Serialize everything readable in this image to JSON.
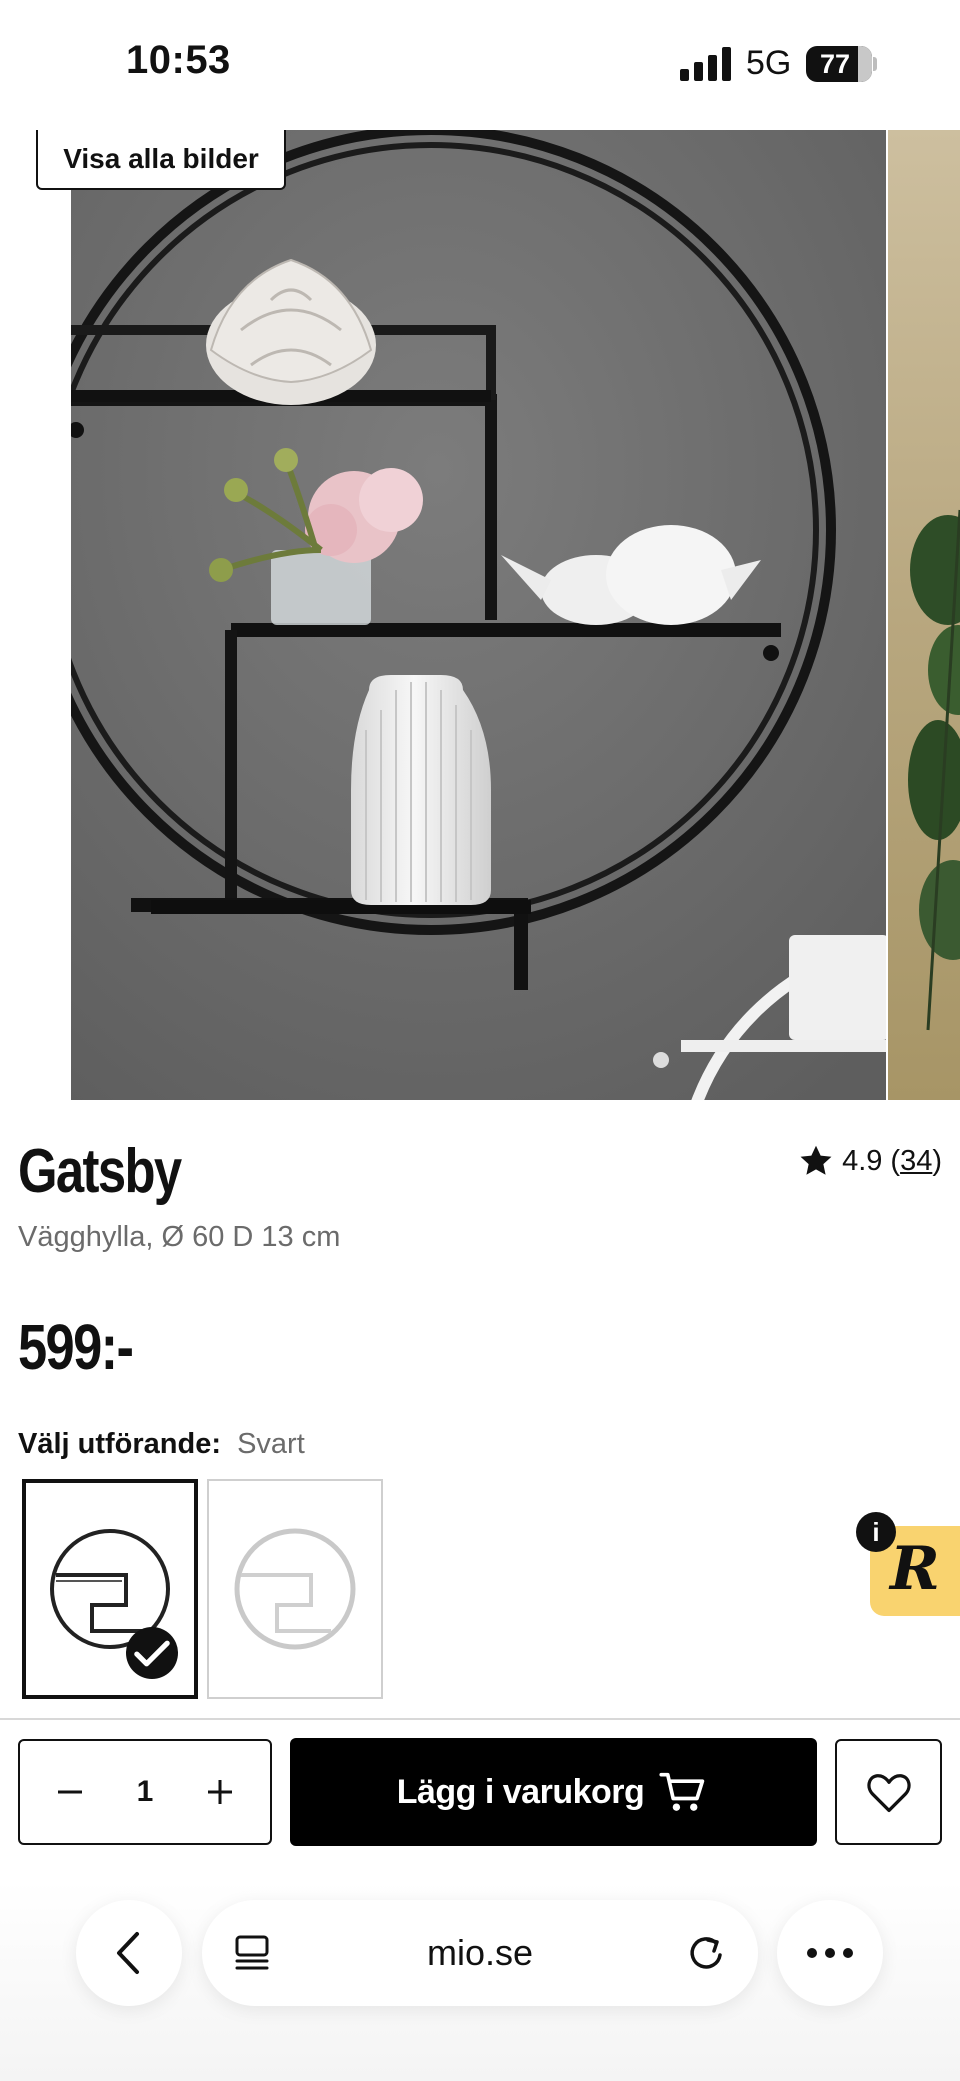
{
  "status_bar": {
    "time": "10:53",
    "network": "5G",
    "battery": "77"
  },
  "gallery": {
    "view_all_label": "Visa alla bilder"
  },
  "product": {
    "title": "Gatsby",
    "subtitle": "Vägghylla, Ø 60 D 13 cm",
    "rating": "4.9",
    "rating_count": "34",
    "price": "599:-"
  },
  "variant": {
    "label": "Välj utförande:",
    "selected_value": "Svart",
    "options": [
      {
        "name": "Svart",
        "selected": true
      },
      {
        "name": "Vit",
        "selected": false
      }
    ]
  },
  "purchase": {
    "quantity": "1",
    "add_to_cart_label": "Lägg i varukorg"
  },
  "badge": {
    "info": "i",
    "letter": "R"
  },
  "browser": {
    "url": "mio.se"
  },
  "colors": {
    "accent": "#000000",
    "badge": "#f9d36f",
    "wall": "#6f6f6f"
  }
}
